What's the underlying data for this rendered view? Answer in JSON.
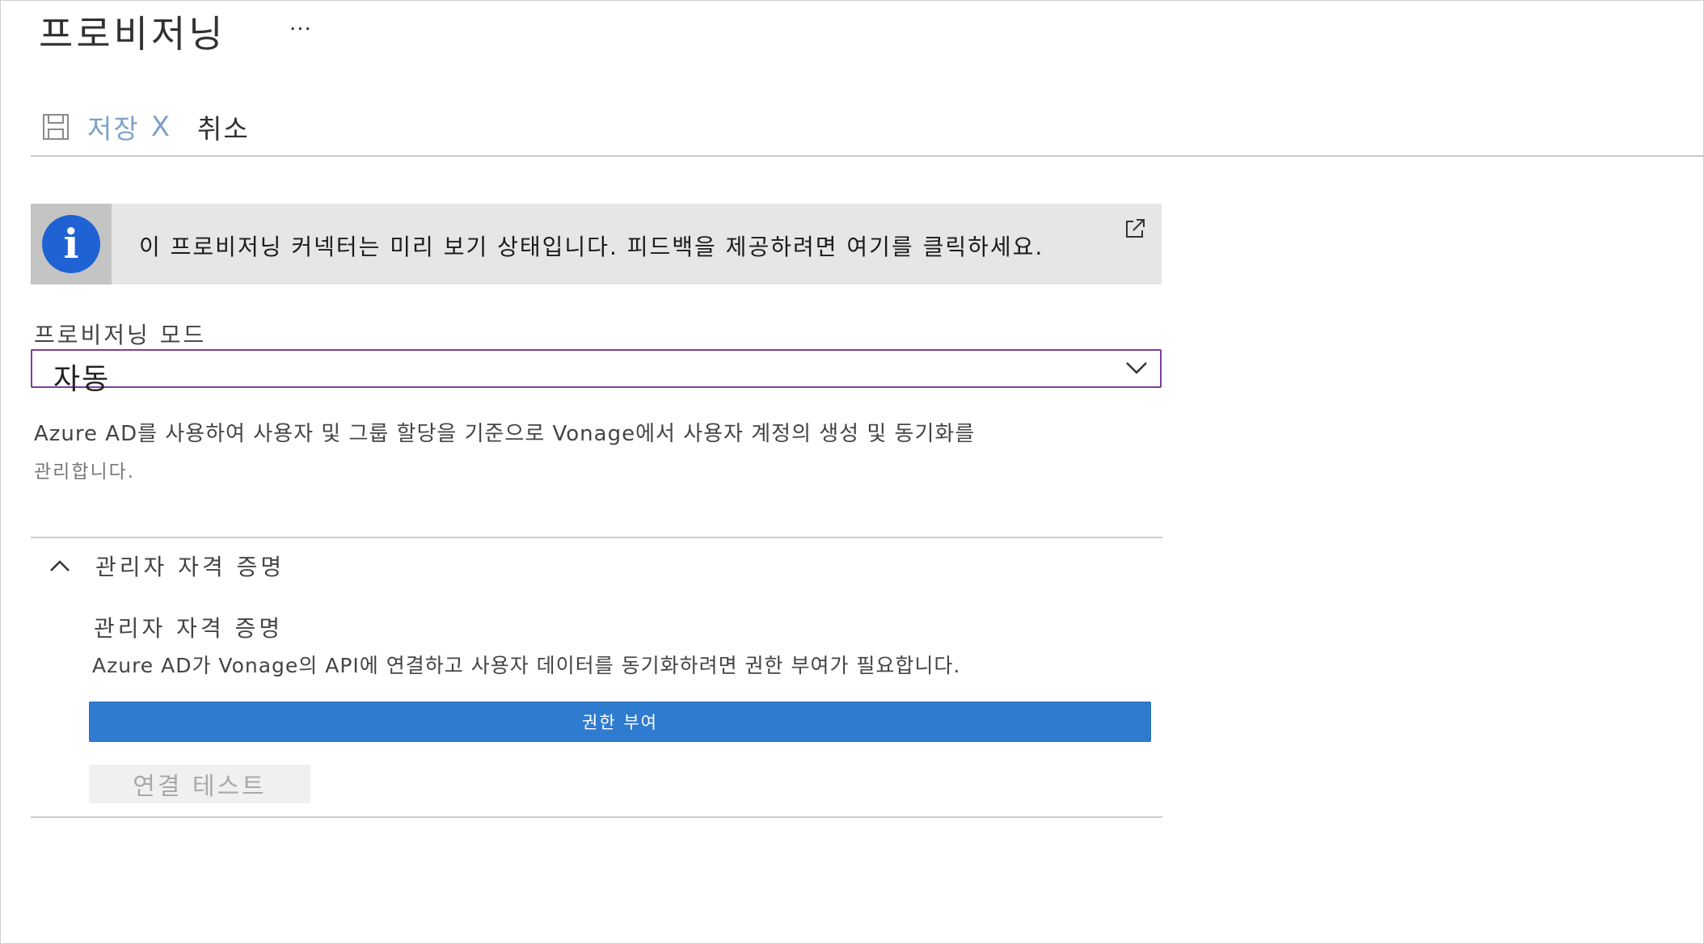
{
  "header": {
    "title": "프로비저닝",
    "more_label": "..."
  },
  "toolbar": {
    "save_label": "저장",
    "cancel_x": "X",
    "cancel_label": "취소"
  },
  "info_banner": {
    "text": "이 프로비저닝 커넥터는 미리 보기 상태입니다. 피드백을 제공하려면 여기를 클릭하세요."
  },
  "provisioning_mode": {
    "label": "프로비저닝 모드",
    "selected_value": "자동",
    "description_line1": "Azure AD를 사용하여 사용자 및 그룹 할당을 기준으로 Vonage에서 사용자 계정의 생성 및 동기화를",
    "description_line2": "관리합니다."
  },
  "admin_credentials": {
    "section_title": "관리자 자격 증명",
    "title": "관리자 자격 증명",
    "description": "Azure AD가 Vonage의 API에 연결하고 사용자 데이터를 동기화하려면 권한 부여가 필요합니다.",
    "authorize_label": "권한 부여",
    "test_connection_label": "연결 테스트"
  },
  "colors": {
    "accent": "#2f7bd0",
    "info_icon": "#1f62d4",
    "select_border": "#7b3f9e",
    "save_disabled": "#7fa1c9"
  },
  "icons": {
    "save": "save-icon",
    "info": "info-icon",
    "external_link": "external-link-icon",
    "dropdown": "chevron-down-icon",
    "collapse": "chevron-up-icon"
  }
}
